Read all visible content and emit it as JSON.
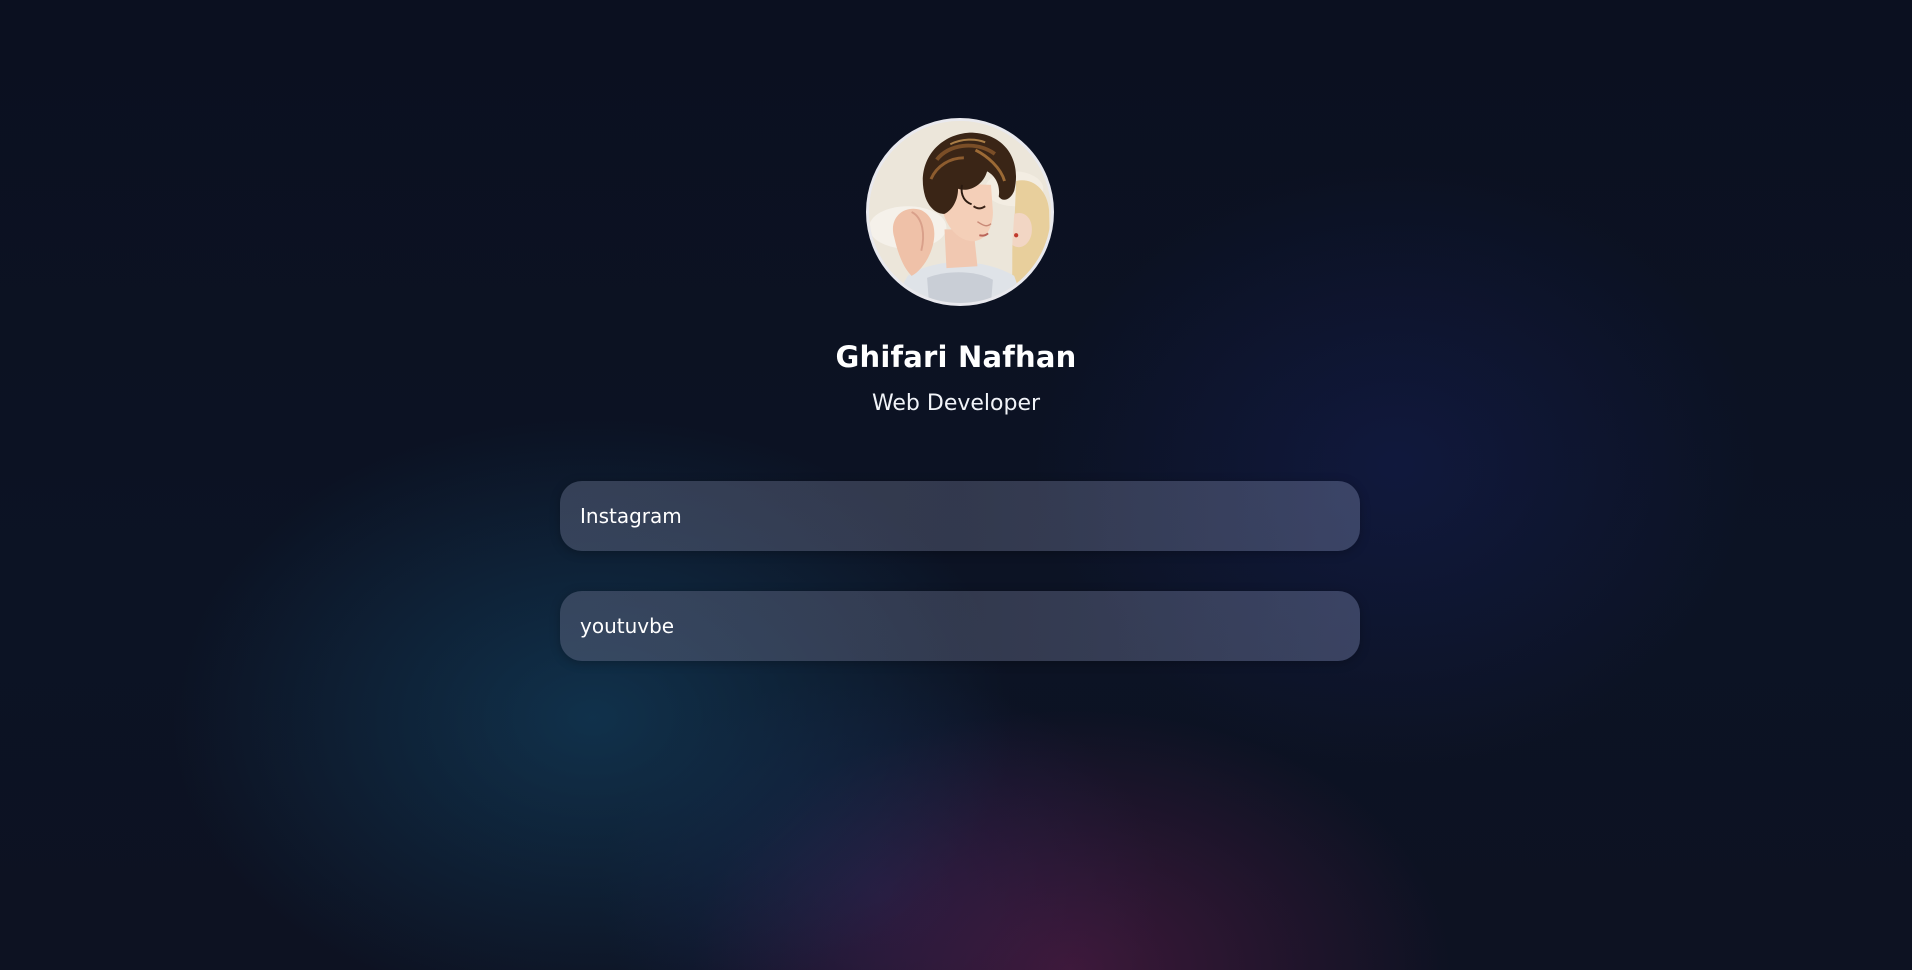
{
  "profile": {
    "name": "Ghifari Nafhan",
    "role": "Web Developer",
    "avatar_icon": "illustrated-couple-portrait"
  },
  "links": [
    {
      "label": "Instagram"
    },
    {
      "label": "youtuvbe"
    }
  ],
  "colors": {
    "background": "#0c1222",
    "button_fill": "#4a5266",
    "text": "#ffffff"
  }
}
